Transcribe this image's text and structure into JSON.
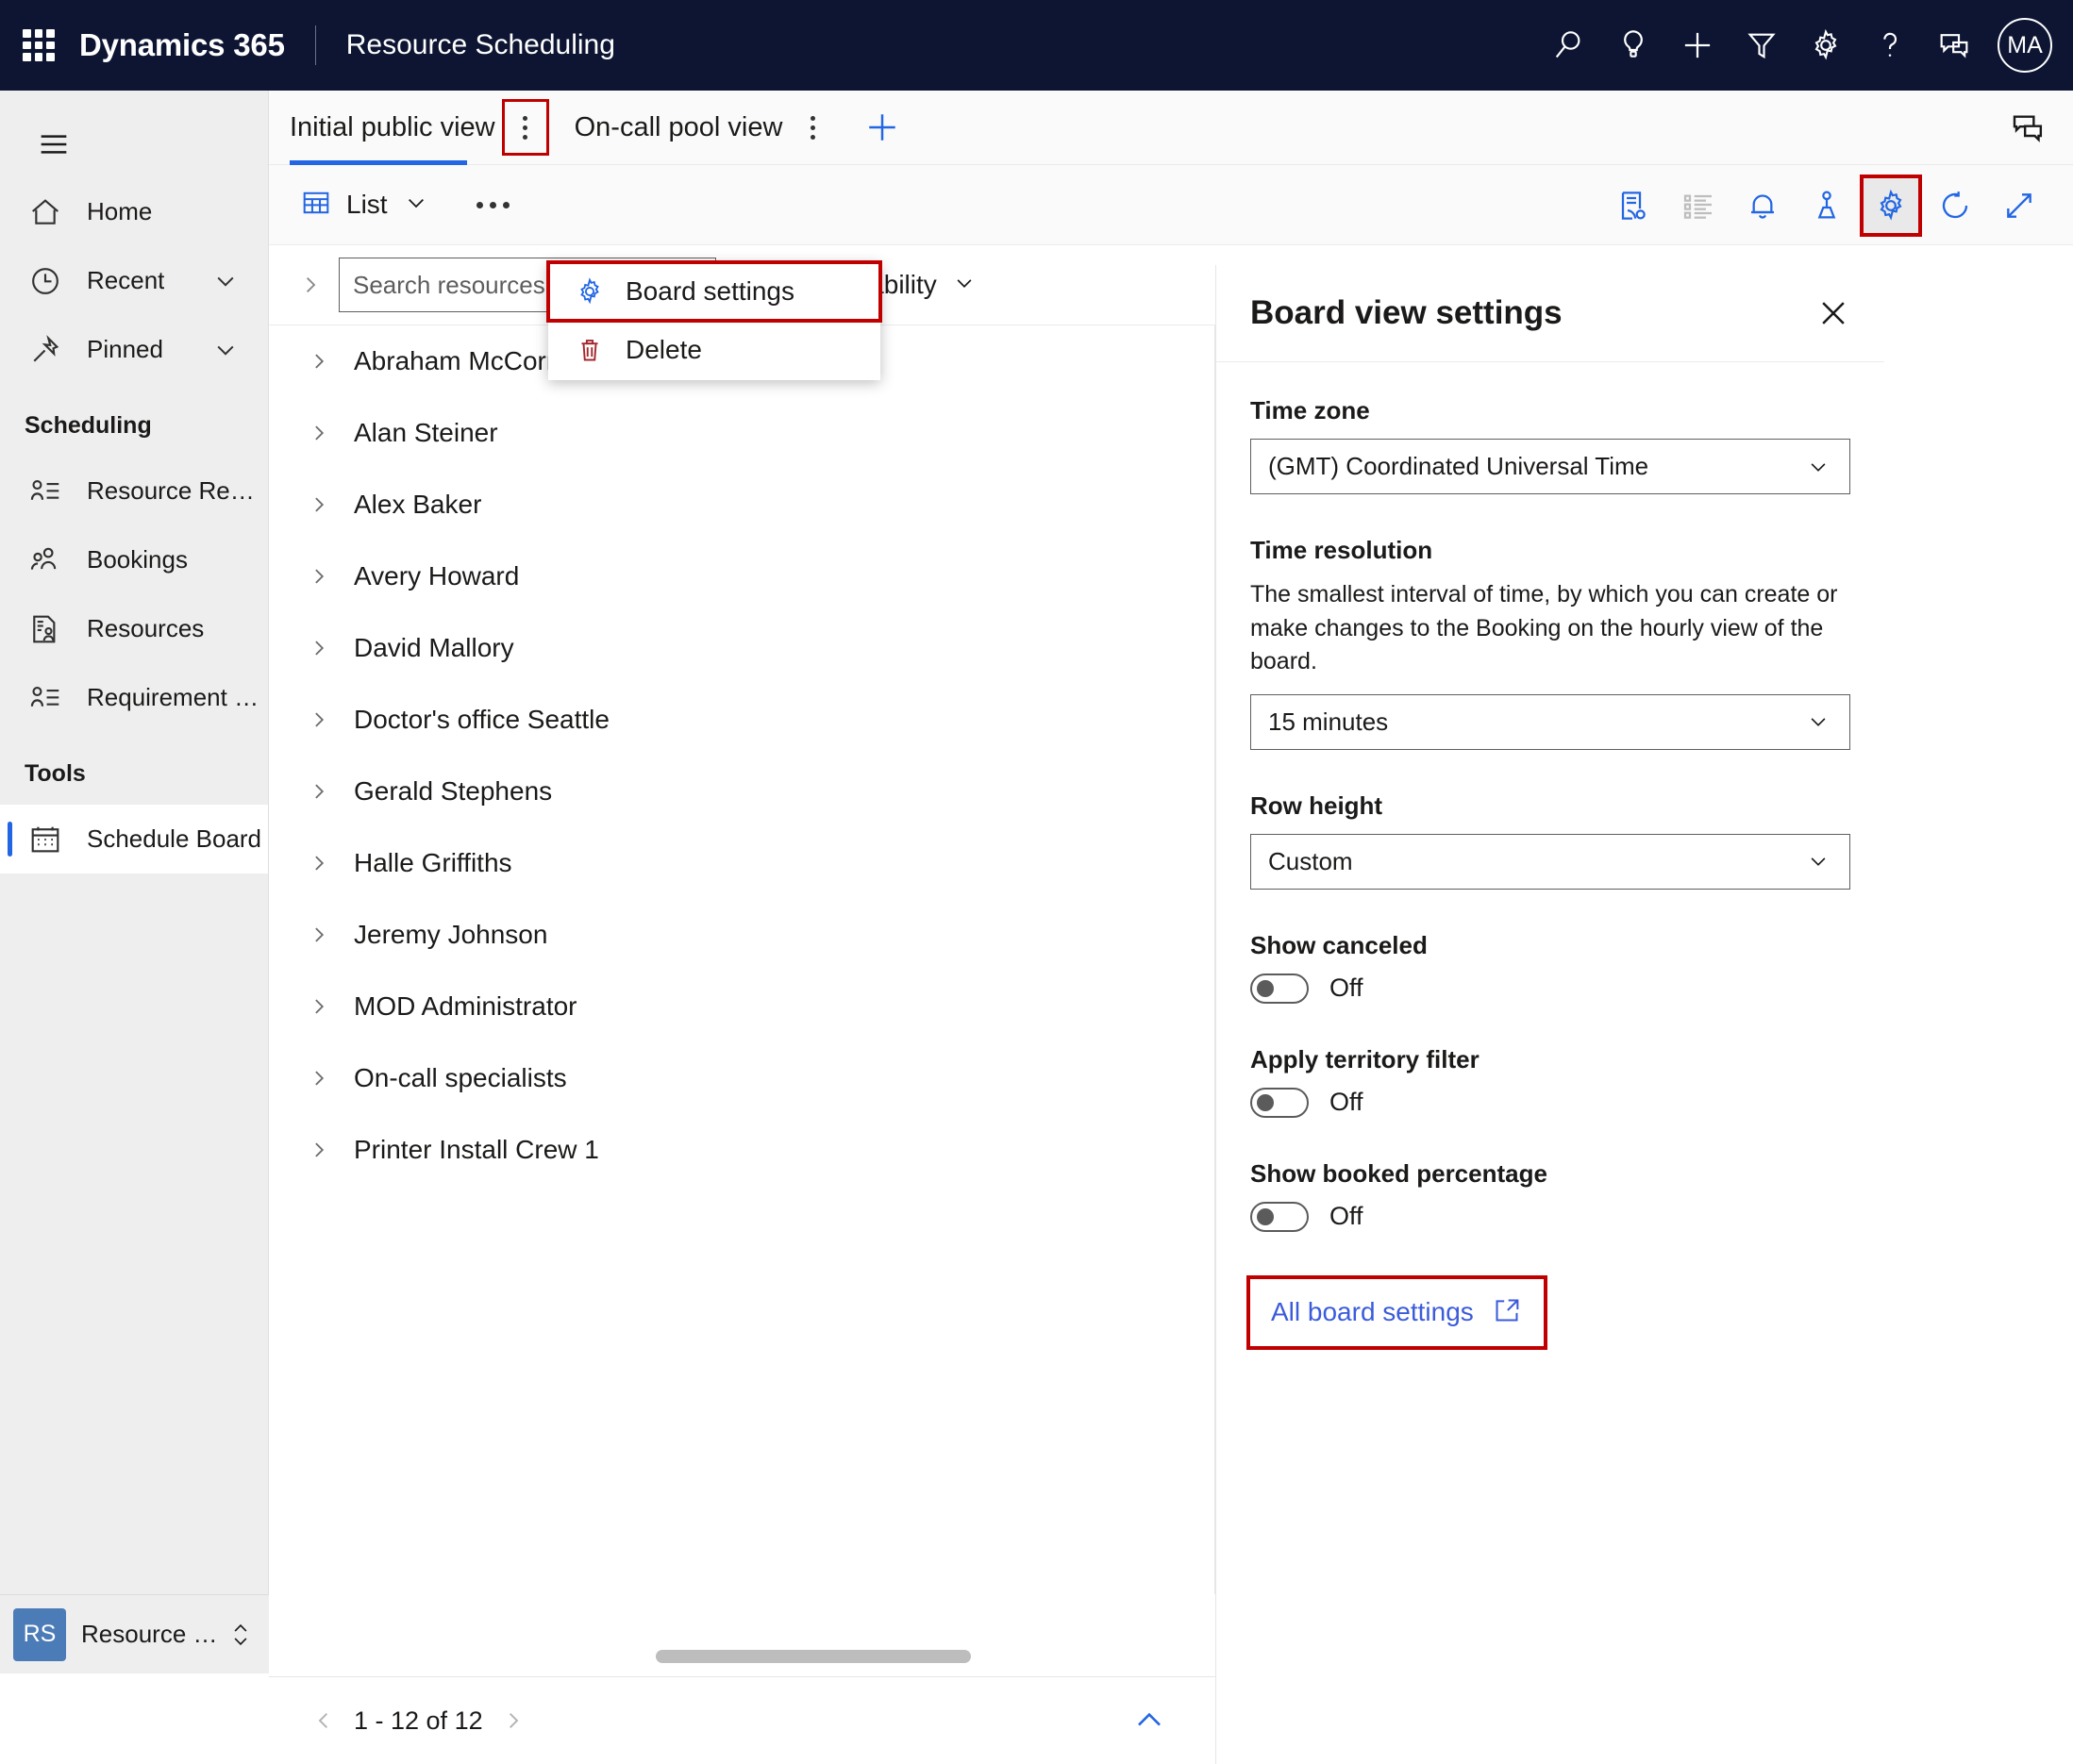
{
  "topbar": {
    "waffle_icon": "waffle-grid-icon",
    "brand": "Dynamics 365",
    "app_name": "Resource Scheduling",
    "icons": [
      {
        "name": "search-icon",
        "label": "Search"
      },
      {
        "name": "lightbulb-icon",
        "label": "Insights"
      },
      {
        "name": "plus-icon",
        "label": "New"
      },
      {
        "name": "filter-icon",
        "label": "Filter"
      },
      {
        "name": "gear-icon",
        "label": "Settings"
      },
      {
        "name": "question-icon",
        "label": "Help"
      },
      {
        "name": "feedback-chat-icon",
        "label": "Feedback"
      }
    ],
    "avatar_initials": "MA"
  },
  "sidebar": {
    "hamburger_icon": "hamburger-menu-icon",
    "items": [
      {
        "label": "Home",
        "icon": "home-icon",
        "chevron": false,
        "selected": false
      },
      {
        "label": "Recent",
        "icon": "clock-icon",
        "chevron": true,
        "selected": false
      },
      {
        "label": "Pinned",
        "icon": "pin-icon",
        "chevron": true,
        "selected": false
      }
    ],
    "groups": [
      {
        "title": "Scheduling",
        "items": [
          {
            "label": "Resource Requireme...",
            "icon": "person-list-icon",
            "selected": false
          },
          {
            "label": "Bookings",
            "icon": "people-icon",
            "selected": false
          },
          {
            "label": "Resources",
            "icon": "document-person-icon",
            "selected": false
          },
          {
            "label": "Requirement Groups",
            "icon": "person-list-icon",
            "selected": false
          }
        ]
      },
      {
        "title": "Tools",
        "items": [
          {
            "label": "Schedule Board",
            "icon": "calendar-icon",
            "selected": true
          }
        ]
      }
    ],
    "app_switcher": {
      "badge": "RS",
      "label": "Resource Schedul...",
      "chevron_icon": "chevron-updown-icon"
    }
  },
  "tabs": {
    "items": [
      {
        "label": "Initial public view",
        "active": true,
        "kebab_highlighted": true
      },
      {
        "label": "On-call pool view",
        "active": false,
        "kebab_highlighted": false
      }
    ],
    "add_tab_icon": "plus-icon",
    "corner_chat_icon": "chat-bubbles-icon"
  },
  "context_menu": {
    "items": [
      {
        "label": "Board settings",
        "icon": "gear-icon",
        "highlighted": true
      },
      {
        "label": "Delete",
        "icon": "trash-icon",
        "highlighted": false
      }
    ]
  },
  "toolbar": {
    "view_mode_icon": "grid-table-icon",
    "view_mode_label": "List",
    "view_mode_chevron": "chevron-down-icon",
    "overflow_label": "More commands",
    "right_icons": [
      {
        "name": "requirements-panel-icon",
        "state": "enabled",
        "highlighted": false
      },
      {
        "name": "bulleted-list-icon",
        "state": "disabled",
        "highlighted": false
      },
      {
        "name": "bell-icon",
        "state": "enabled",
        "highlighted": false
      },
      {
        "name": "map-pin-person-icon",
        "state": "enabled",
        "highlighted": false
      },
      {
        "name": "gear-icon",
        "state": "enabled",
        "highlighted": true
      },
      {
        "name": "refresh-icon",
        "state": "enabled",
        "highlighted": false
      },
      {
        "name": "expand-diagonal-icon",
        "state": "enabled",
        "highlighted": false
      }
    ]
  },
  "filterbar": {
    "expand_chevron_icon": "chevron-right-icon",
    "search_placeholder": "Search resources",
    "search_value": "",
    "sort_icon": "sort-updown-icon",
    "availability_label": "Availability",
    "availability_chevron": "chevron-down-icon"
  },
  "resource_list": {
    "row_chevron_icon": "chevron-right-icon",
    "rows": [
      {
        "label": "Abraham McCormick MD"
      },
      {
        "label": "Alan Steiner"
      },
      {
        "label": "Alex Baker"
      },
      {
        "label": "Avery Howard"
      },
      {
        "label": "David Mallory"
      },
      {
        "label": "Doctor's office Seattle"
      },
      {
        "label": "Gerald Stephens"
      },
      {
        "label": "Halle Griffiths"
      },
      {
        "label": "Jeremy Johnson"
      },
      {
        "label": "MOD Administrator"
      },
      {
        "label": "On-call specialists"
      },
      {
        "label": "Printer Install Crew 1"
      }
    ]
  },
  "footer": {
    "prev_icon": "chevron-left-icon",
    "page_text": "1 - 12 of 12",
    "next_icon": "chevron-right-icon",
    "collapse_icon": "chevron-up-icon"
  },
  "panel": {
    "title": "Board view settings",
    "close_icon": "close-icon",
    "fields": [
      {
        "type": "combo",
        "label": "Time zone",
        "value": "(GMT) Coordinated Universal Time",
        "help": "",
        "chevron_icon": "chevron-down-icon"
      },
      {
        "type": "combo",
        "label": "Time resolution",
        "help": "The smallest interval of time, by which you can create or make changes to the Booking on the hourly view of the board.",
        "value": "15 minutes",
        "chevron_icon": "chevron-down-icon"
      },
      {
        "type": "combo",
        "label": "Row height",
        "help": "",
        "value": "Custom",
        "chevron_icon": "chevron-down-icon"
      },
      {
        "type": "toggle",
        "label": "Show canceled",
        "state": "Off",
        "on": false
      },
      {
        "type": "toggle",
        "label": "Apply territory filter",
        "state": "Off",
        "on": false
      },
      {
        "type": "toggle",
        "label": "Show booked percentage",
        "state": "Off",
        "on": false
      }
    ],
    "all_settings_link": {
      "label": "All board settings",
      "icon": "open-in-new-icon",
      "highlighted": true
    }
  },
  "colors": {
    "topbar_bg": "#0d1533",
    "accent_blue": "#2266e3",
    "link_blue": "#3b5bdb",
    "highlight_red": "#c00000",
    "sidebar_bg": "#eeeeee",
    "badge_blue": "#4c7cb8"
  }
}
